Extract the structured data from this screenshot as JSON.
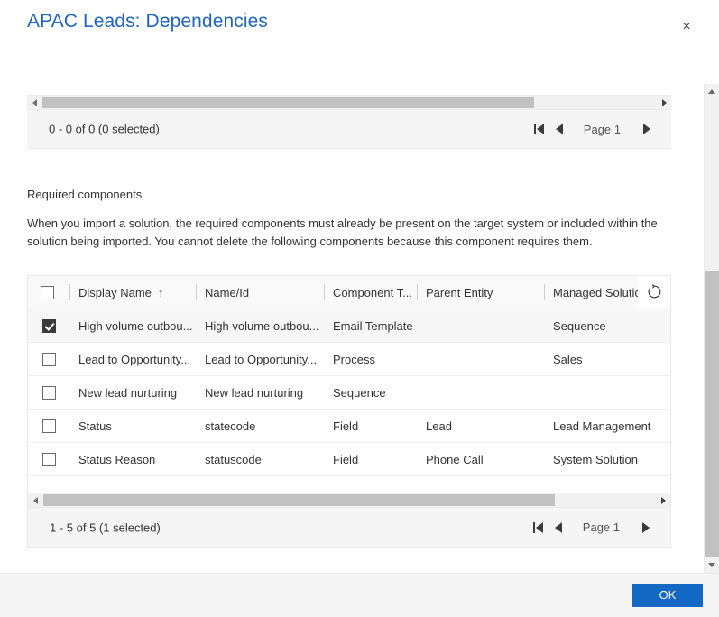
{
  "dialog": {
    "title": "APAC Leads: Dependencies",
    "close_label": "×"
  },
  "top_grid": {
    "pager": {
      "count_text": "0 - 0 of 0 (0 selected)",
      "page_label": "Page 1",
      "first_title": "First page",
      "prev_title": "Previous page",
      "next_title": "Next page"
    }
  },
  "required_section": {
    "label": "Required components",
    "description": "When you import a solution, the required components must already be present on the target system or included within the solution being imported. You cannot delete the following components because this component requires them."
  },
  "table": {
    "select_all_name": "select-all-checkbox",
    "refresh_icon": "refresh-spinner-icon",
    "columns": [
      {
        "label": "Display Name",
        "sort": "↑"
      },
      {
        "label": "Name/Id",
        "sort": ""
      },
      {
        "label": "Component T...",
        "sort": ""
      },
      {
        "label": "Parent Entity",
        "sort": ""
      },
      {
        "label": "Managed Solution",
        "sort": ""
      }
    ],
    "rows": [
      {
        "selected": true,
        "display_name": "High volume outbou...",
        "name_id": "High volume outbou...",
        "component_type": "Email Template",
        "parent_entity": "",
        "managed_solution": "Sequence"
      },
      {
        "selected": false,
        "display_name": "Lead to Opportunity...",
        "name_id": "Lead to Opportunity...",
        "component_type": "Process",
        "parent_entity": "",
        "managed_solution": "Sales"
      },
      {
        "selected": false,
        "display_name": "New lead nurturing",
        "name_id": "New lead nurturing",
        "component_type": "Sequence",
        "parent_entity": "",
        "managed_solution": ""
      },
      {
        "selected": false,
        "display_name": "Status",
        "name_id": "statecode",
        "component_type": "Field",
        "parent_entity": "Lead",
        "managed_solution": "Lead Management"
      },
      {
        "selected": false,
        "display_name": "Status Reason",
        "name_id": "statuscode",
        "component_type": "Field",
        "parent_entity": "Phone Call",
        "managed_solution": "System Solution"
      }
    ]
  },
  "bottom_grid": {
    "pager": {
      "count_text": "1 - 5 of 5 (1 selected)",
      "page_label": "Page 1",
      "first_title": "First page",
      "prev_title": "Previous page",
      "next_title": "Next page"
    }
  },
  "footer": {
    "ok_label": "OK"
  },
  "colors": {
    "title": "#2266bb",
    "primary_button": "#1268c3",
    "scroll_thumb": "#c1c1c1",
    "pager_bg": "#f5f5f5"
  }
}
